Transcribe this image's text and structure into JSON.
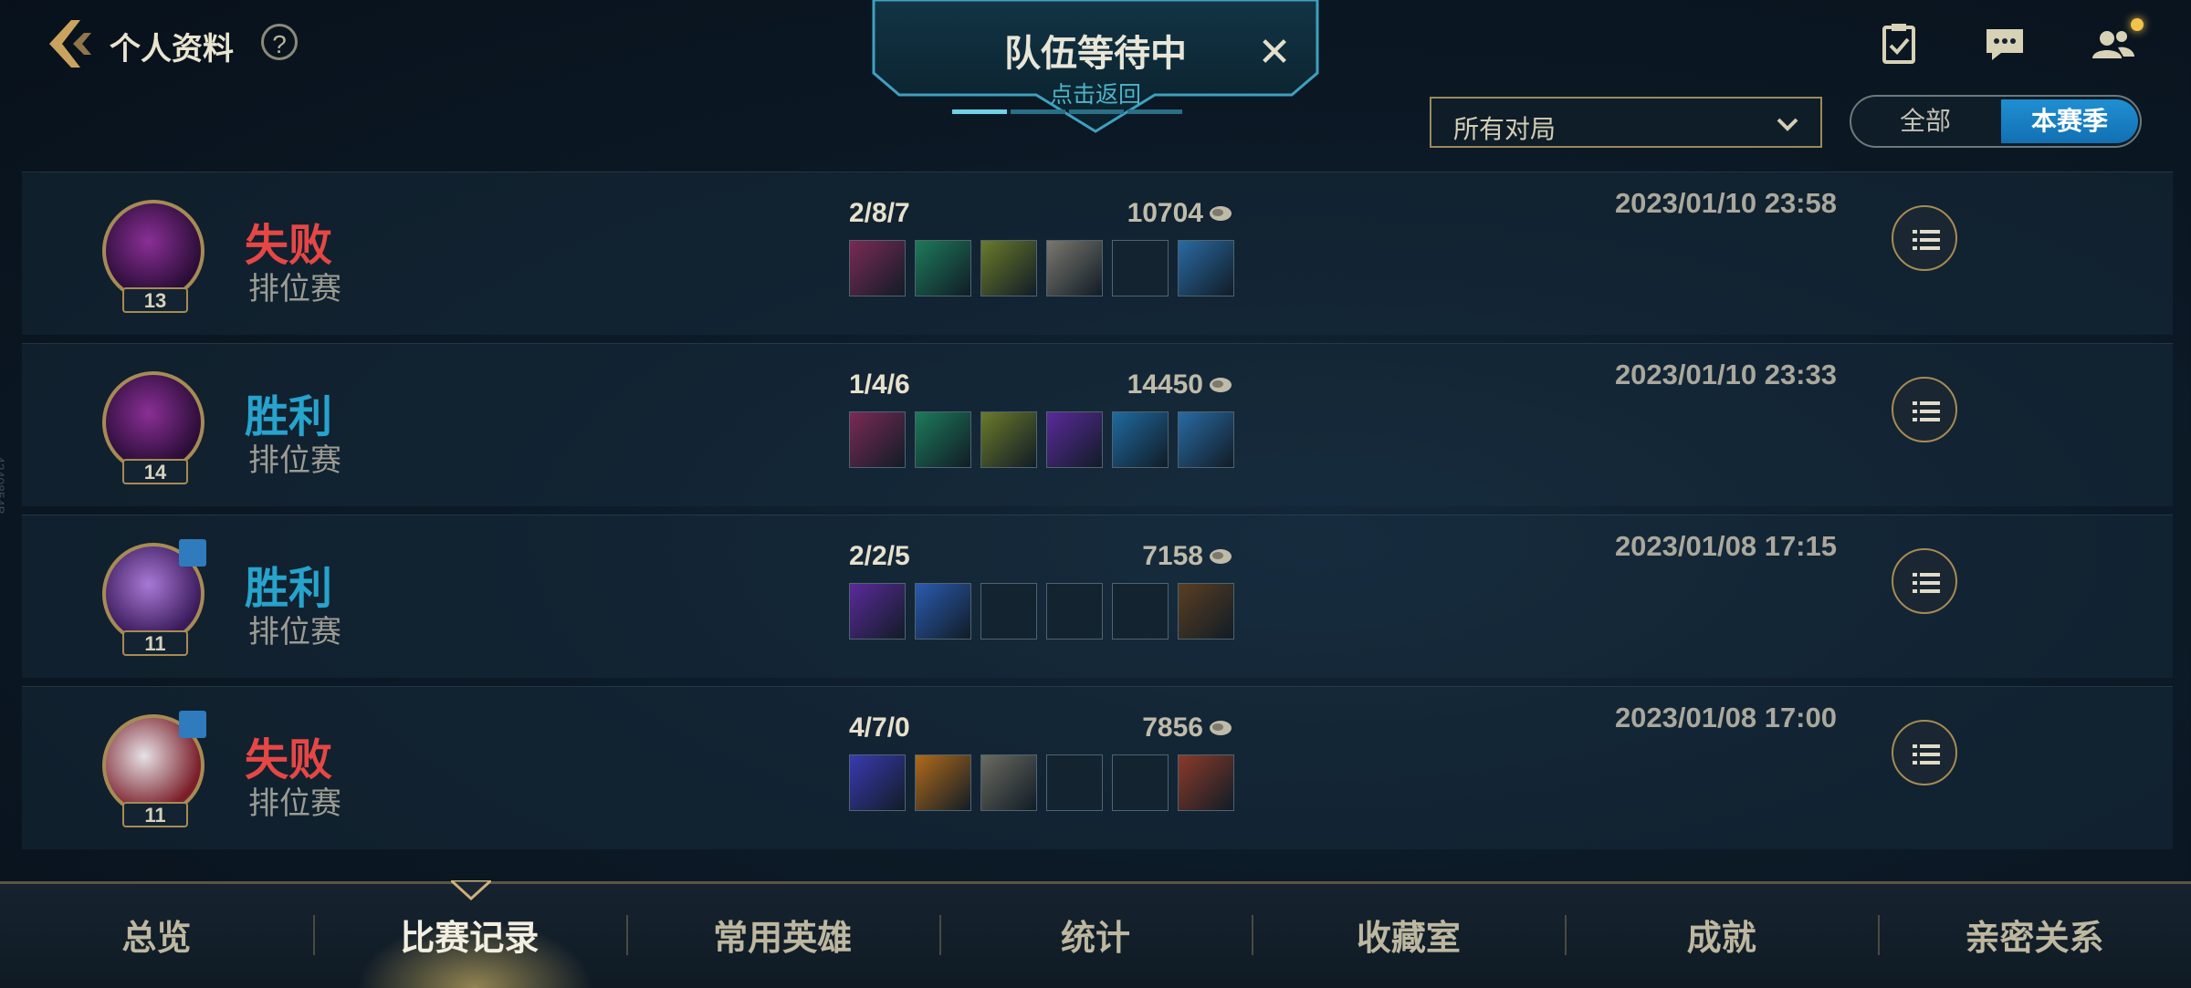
{
  "header": {
    "title": "个人资料",
    "help": "?"
  },
  "queue": {
    "title": "队伍等待中",
    "subtitle": "点击返回",
    "close": "✕"
  },
  "filter": {
    "selected": "所有对局"
  },
  "season_toggle": {
    "all": "全部",
    "season": "本赛季",
    "active": "season"
  },
  "matches": [
    {
      "level": "13",
      "result": "失败",
      "mode": "排位赛",
      "kda": "2/8/7",
      "gold": "10704",
      "date": "2023/01/10 23:58",
      "party": false,
      "outcome": "lose"
    },
    {
      "level": "14",
      "result": "胜利",
      "mode": "排位赛",
      "kda": "1/4/6",
      "gold": "14450",
      "date": "2023/01/10 23:33",
      "party": false,
      "outcome": "win"
    },
    {
      "level": "11",
      "result": "胜利",
      "mode": "排位赛",
      "kda": "2/2/5",
      "gold": "7158",
      "date": "2023/01/08 17:15",
      "party": true,
      "outcome": "win"
    },
    {
      "level": "11",
      "result": "失败",
      "mode": "排位赛",
      "kda": "4/7/0",
      "gold": "7856",
      "date": "2023/01/08 17:00",
      "party": true,
      "outcome": "lose"
    }
  ],
  "tabs": [
    "总览",
    "比赛记录",
    "常用英雄",
    "统计",
    "收藏室",
    "成就",
    "亲密关系"
  ],
  "active_tab": "比赛记录",
  "side_id": "4240854B",
  "colors": {
    "lose": "#e64745",
    "win": "#27a3cc",
    "accent_gold": "#a68b55",
    "toggle_active": "#1a84c8"
  }
}
